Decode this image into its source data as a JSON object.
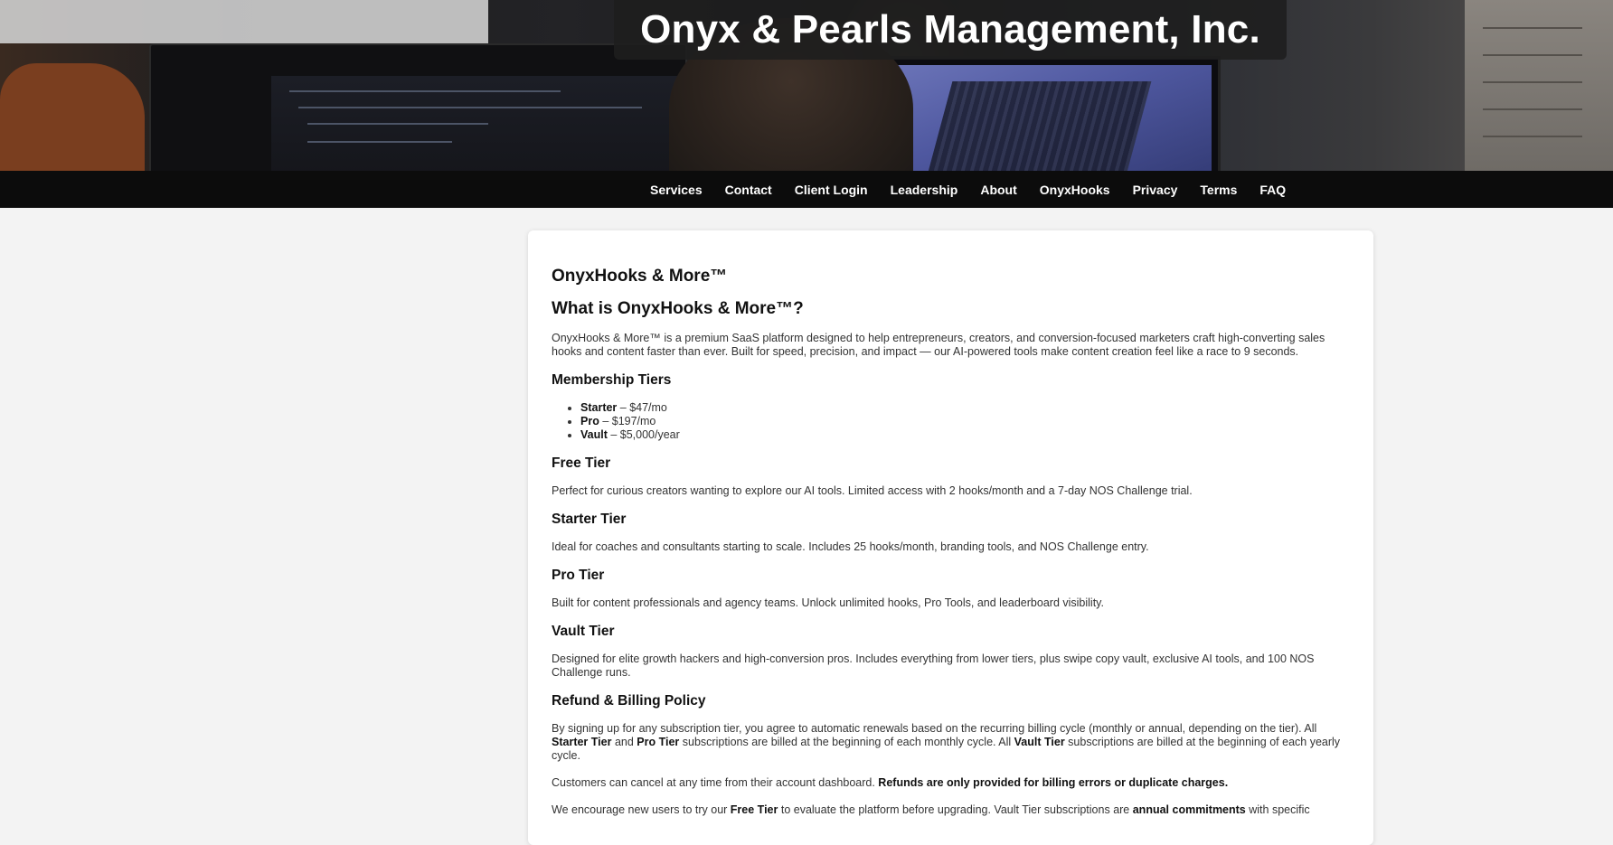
{
  "site": {
    "title": "Onyx & Pearls Management, Inc."
  },
  "nav": {
    "items": [
      {
        "label": "Services"
      },
      {
        "label": "Contact"
      },
      {
        "label": "Client Login"
      },
      {
        "label": "Leadership"
      },
      {
        "label": "About"
      },
      {
        "label": "OnyxHooks"
      },
      {
        "label": "Privacy"
      },
      {
        "label": "Terms"
      },
      {
        "label": "FAQ"
      }
    ]
  },
  "content": {
    "heading": "OnyxHooks & More™",
    "what_heading": "What is OnyxHooks & More™?",
    "intro": "OnyxHooks & More™ is a premium SaaS platform designed to help entrepreneurs, creators, and conversion-focused marketers craft high-converting sales hooks and content faster than ever. Built for speed, precision, and impact — our AI-powered tools make content creation feel like a race to 9 seconds.",
    "membership_heading": "Membership Tiers",
    "membership": [
      {
        "name": "Starter",
        "price": " – $47/mo"
      },
      {
        "name": "Pro",
        "price": " – $197/mo"
      },
      {
        "name": "Vault",
        "price": " – $5,000/year"
      }
    ],
    "free_heading": "Free Tier",
    "free_text": "Perfect for curious creators wanting to explore our AI tools. Limited access with 2 hooks/month and a 7-day NOS Challenge trial.",
    "starter_heading": "Starter Tier",
    "starter_text": "Ideal for coaches and consultants starting to scale. Includes 25 hooks/month, branding tools, and NOS Challenge entry.",
    "pro_heading": "Pro Tier",
    "pro_text": "Built for content professionals and agency teams. Unlock unlimited hooks, Pro Tools, and leaderboard visibility.",
    "vault_heading": "Vault Tier",
    "vault_text": "Designed for elite growth hackers and high-conversion pros. Includes everything from lower tiers, plus swipe copy vault, exclusive AI tools, and 100 NOS Challenge runs.",
    "refund_heading": "Refund & Billing Policy",
    "refund": {
      "p1_a": "By signing up for any subscription tier, you agree to automatic renewals based on the recurring billing cycle (monthly or annual, depending on the tier). All ",
      "p1_b": "Starter Tier",
      "p1_c": " and ",
      "p1_d": "Pro Tier",
      "p1_e": " subscriptions are billed at the beginning of each monthly cycle. All ",
      "p1_f": "Vault Tier",
      "p1_g": " subscriptions are billed at the beginning of each yearly cycle.",
      "p2_a": "Customers can cancel at any time from their account dashboard. ",
      "p2_b": "Refunds are only provided for billing errors or duplicate charges.",
      "p3_a": "We encourage new users to try our ",
      "p3_b": "Free Tier",
      "p3_c": " to evaluate the platform before upgrading. Vault Tier subscriptions are ",
      "p3_d": "annual commitments",
      "p3_e": " with specific"
    }
  }
}
